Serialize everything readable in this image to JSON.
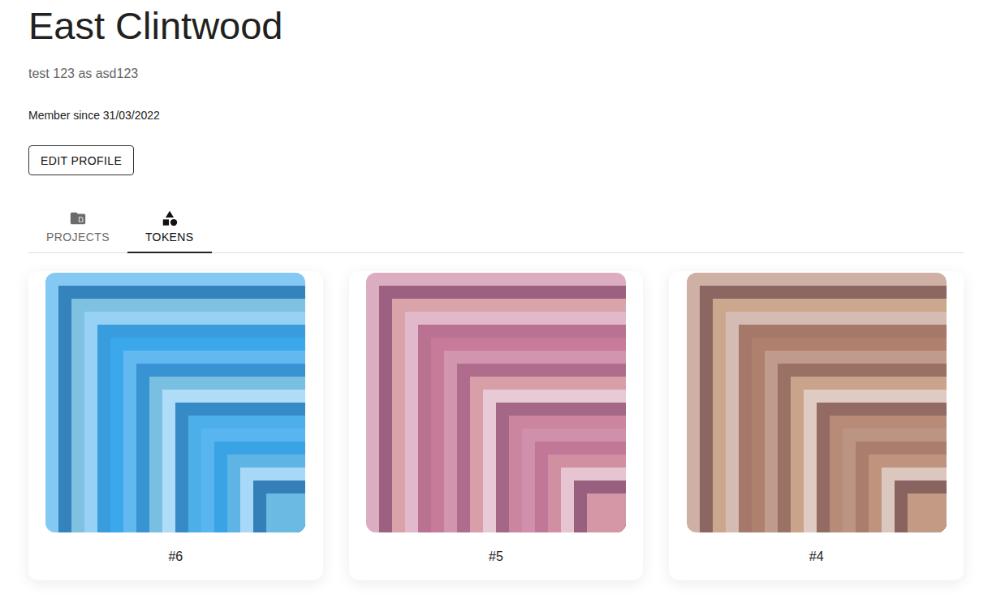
{
  "profile": {
    "name": "East Clintwood",
    "bio": "test 123 as asd123",
    "member_since": "Member since 31/03/2022"
  },
  "buttons": [
    "EDIT PROFILE"
  ],
  "tabs": [
    {
      "label": "PROJECTS",
      "selected": false
    },
    {
      "label": "TOKENS",
      "selected": true
    }
  ],
  "tokens": [
    {
      "label": "#6",
      "color": "#3aa8ec"
    },
    {
      "label": "#5",
      "color": "#c77a9a"
    },
    {
      "label": "#4",
      "color": "#b0806e"
    }
  ]
}
